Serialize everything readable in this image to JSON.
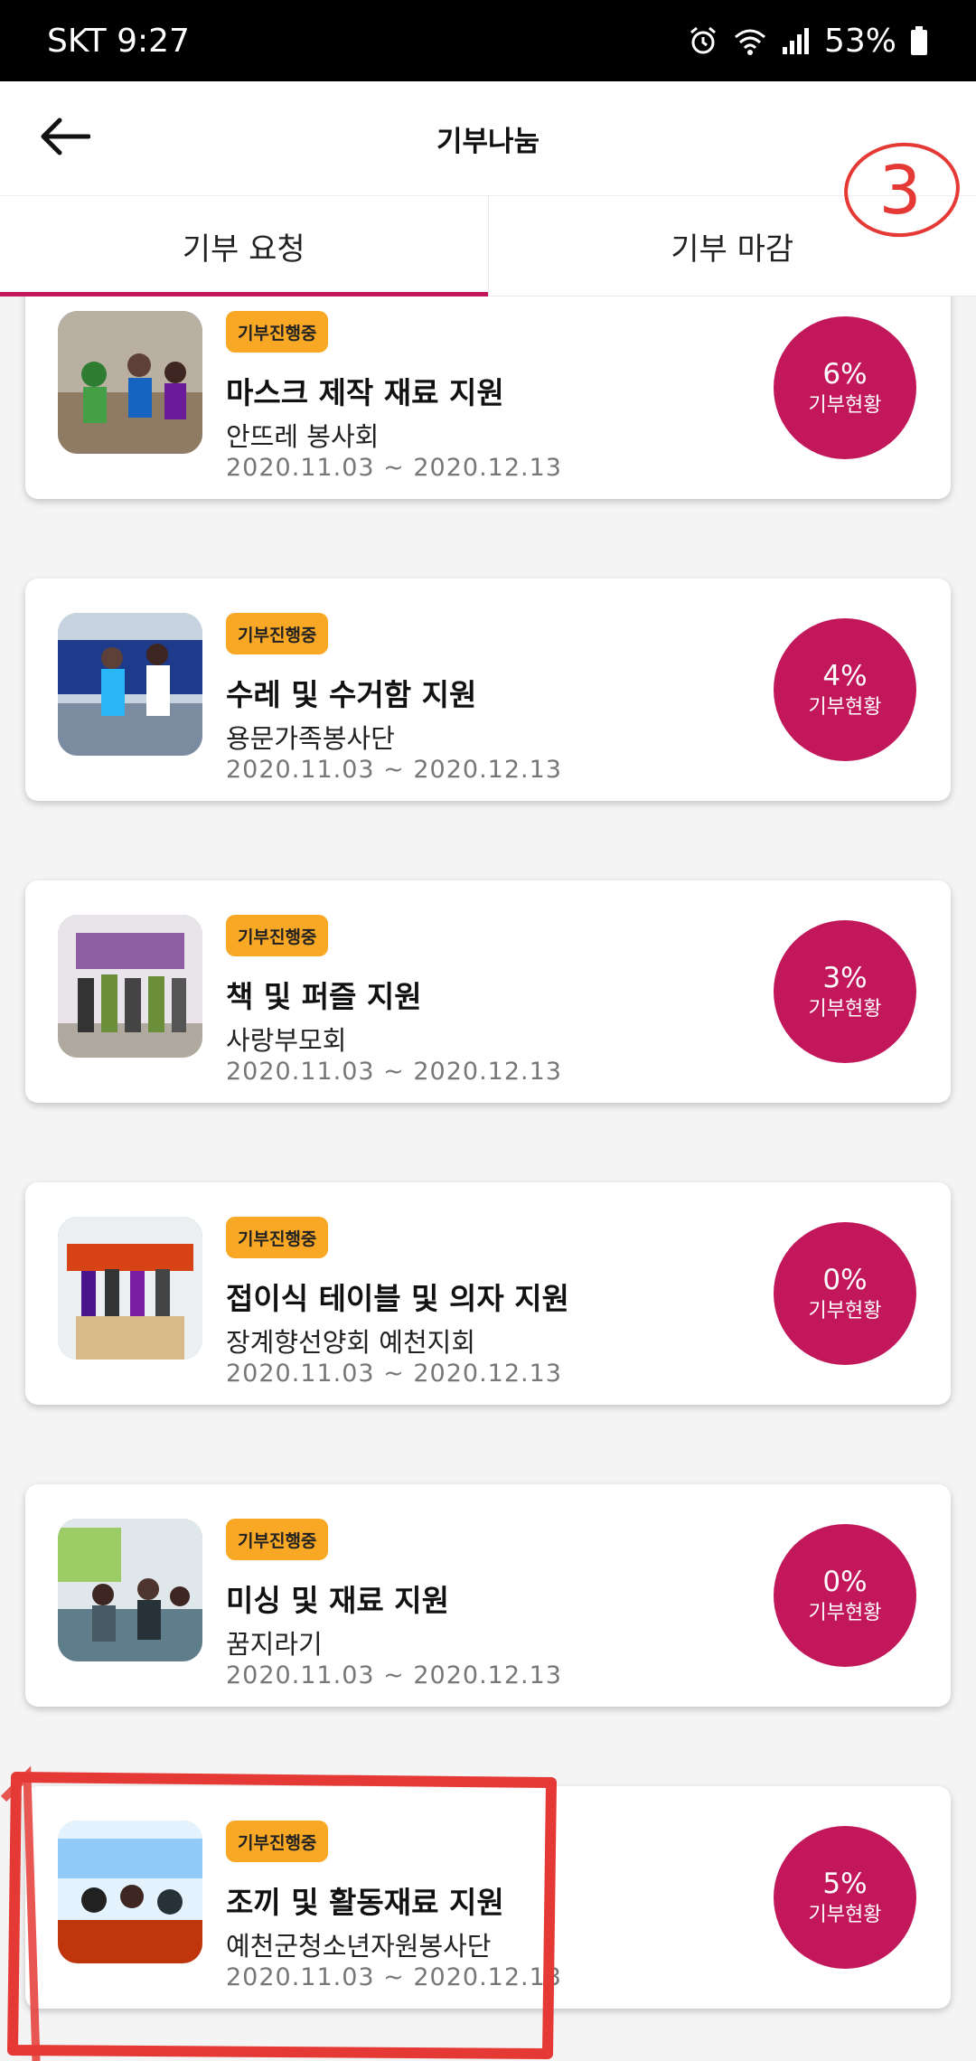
{
  "status_bar": {
    "carrier": "SKT",
    "time": "9:27",
    "battery": "53%",
    "icons": [
      "alarm-icon",
      "wifi-icon",
      "signal-icon",
      "battery-icon"
    ]
  },
  "header": {
    "title": "기부나눔",
    "back_icon": "arrow-left-icon"
  },
  "tabs": [
    {
      "label": "기부 요청",
      "active": true
    },
    {
      "label": "기부 마감",
      "active": false
    }
  ],
  "colors": {
    "accent": "#c2185b",
    "badge": "#f9a825",
    "annotation": "#e53935"
  },
  "annotation": {
    "number": "3"
  },
  "donations": [
    {
      "badge": "기부진행중",
      "title": "마스크 제작 재료 지원",
      "org": "안뜨레 봉사회",
      "period": "2020.11.03 ~ 2020.12.13",
      "progress": "6%",
      "progress_label": "기부현황"
    },
    {
      "badge": "기부진행중",
      "title": "수레 및 수거함 지원",
      "org": "용문가족봉사단",
      "period": "2020.11.03 ~ 2020.12.13",
      "progress": "4%",
      "progress_label": "기부현황"
    },
    {
      "badge": "기부진행중",
      "title": "책 및 퍼즐 지원",
      "org": "사랑부모회",
      "period": "2020.11.03 ~ 2020.12.13",
      "progress": "3%",
      "progress_label": "기부현황"
    },
    {
      "badge": "기부진행중",
      "title": "접이식 테이블 및 의자 지원",
      "org": "장계향선양회 예천지회",
      "period": "2020.11.03 ~ 2020.12.13",
      "progress": "0%",
      "progress_label": "기부현황"
    },
    {
      "badge": "기부진행중",
      "title": "미싱 및 재료 지원",
      "org": "꿈지라기",
      "period": "2020.11.03 ~ 2020.12.13",
      "progress": "0%",
      "progress_label": "기부현황"
    },
    {
      "badge": "기부진행중",
      "title": "조끼 및 활동재료 지원",
      "org": "예천군청소년자원봉사단",
      "period": "2020.11.03 ~ 2020.12.13",
      "progress": "5%",
      "progress_label": "기부현황"
    }
  ]
}
